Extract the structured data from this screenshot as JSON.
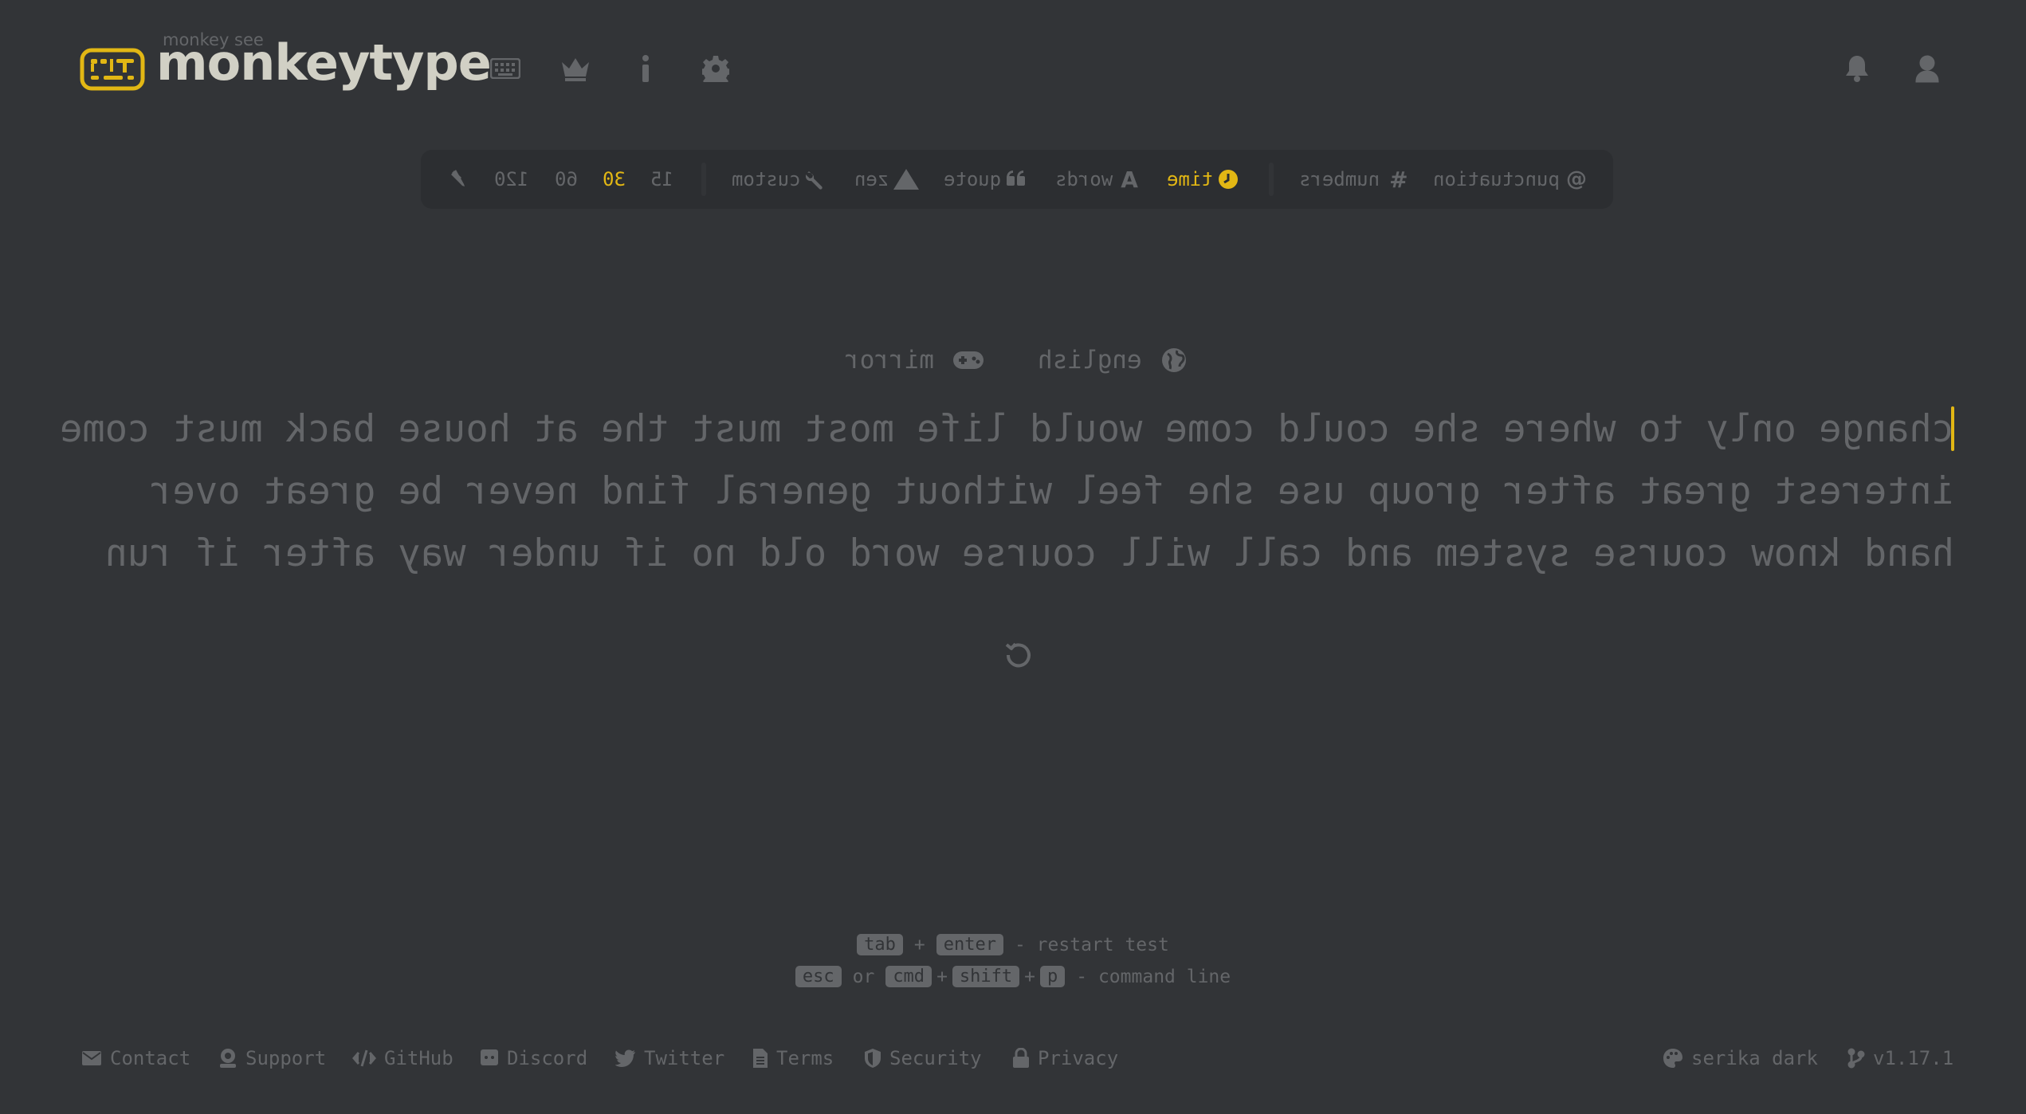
{
  "header": {
    "logo_top": "monkey see",
    "logo_text": "monkeytype",
    "nav_icons": [
      "keyboard-icon",
      "crown-icon",
      "info-icon",
      "gear-icon"
    ],
    "right_icons": [
      "bell-icon",
      "user-icon"
    ]
  },
  "mode_bar": {
    "punctuation": "punctuation",
    "numbers": "numbers",
    "time": "time",
    "words": "words",
    "quote": "quote",
    "zen": "zen",
    "custom": "custom",
    "durations": [
      "15",
      "30",
      "60",
      "120"
    ],
    "active_mode": "time",
    "active_duration": "30"
  },
  "test_info": {
    "language": "english",
    "funbox": "mirror"
  },
  "words": {
    "lines": [
      "change only to where she could come would life most must the at house back must come",
      "interest great after group use she feel without general find never be great over",
      "hand know course system and call will course word old no if under way after if run"
    ]
  },
  "hints": {
    "tab": "tab",
    "plus": "+",
    "enter": "enter",
    "restart_text": "- restart test",
    "esc": "esc",
    "or": "or",
    "cmd": "cmd",
    "shift": "shift",
    "p": "p",
    "command_text": "- command line"
  },
  "footer": {
    "contact": "Contact",
    "support": "Support",
    "github": "GitHub",
    "discord": "Discord",
    "twitter": "Twitter",
    "terms": "Terms",
    "security": "Security",
    "privacy": "Privacy",
    "theme": "serika dark",
    "version": "v1.17.1"
  },
  "colors": {
    "background": "#323437",
    "sub": "#646669",
    "text": "#d1d0c5",
    "accent": "#e2b714",
    "sub_alt": "#2c2e31"
  }
}
